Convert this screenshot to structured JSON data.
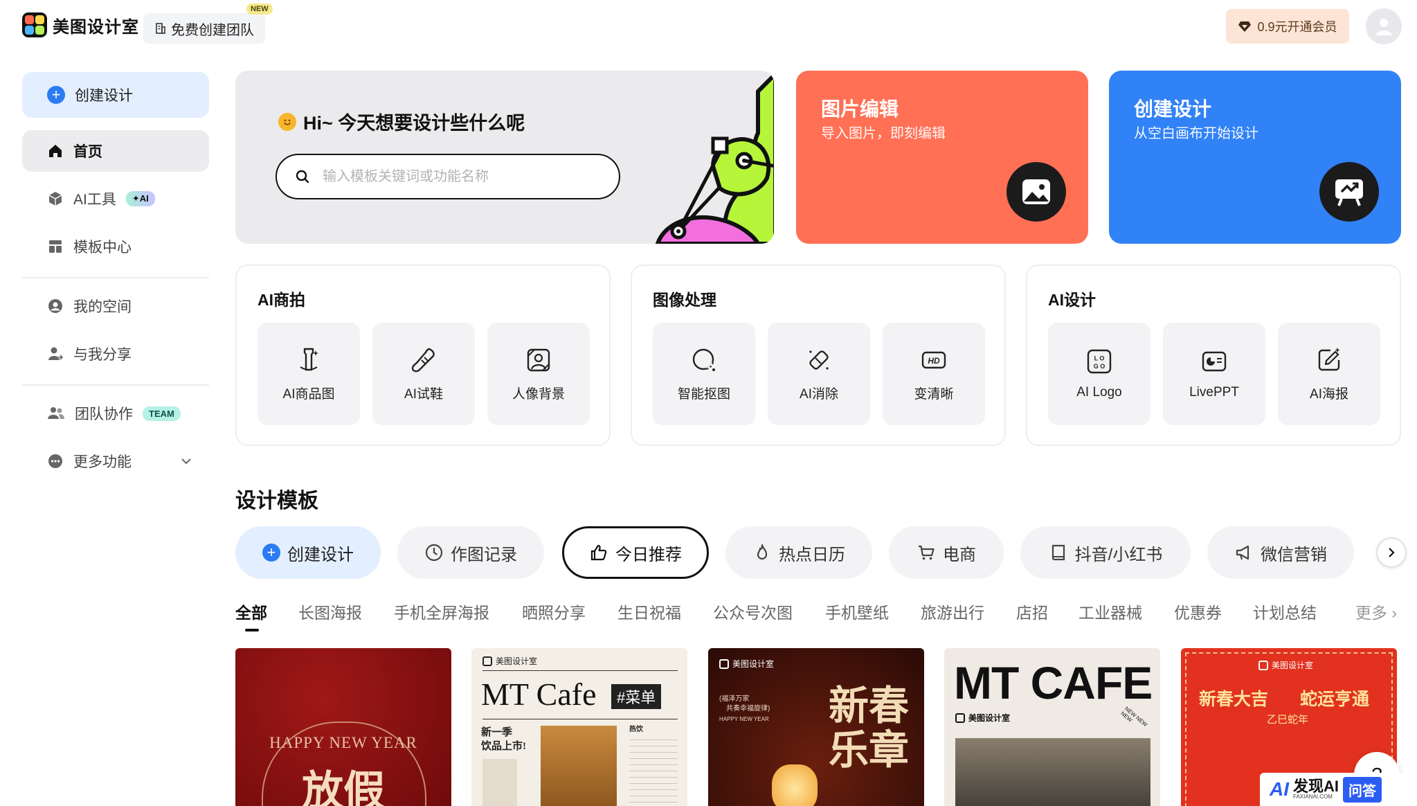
{
  "header": {
    "logo_text": "美图设计室",
    "team_button": "免费创建团队",
    "new_badge": "NEW",
    "vip_button": "0.9元开通会员"
  },
  "sidebar": {
    "create": "创建设计",
    "items": [
      {
        "label": "首页",
        "icon": "home-icon"
      },
      {
        "label": "AI工具",
        "badge": "✦AI",
        "icon": "cube-icon"
      },
      {
        "label": "模板中心",
        "icon": "template-icon"
      },
      {
        "label": "我的空间",
        "icon": "user-icon"
      },
      {
        "label": "与我分享",
        "icon": "share-user-icon"
      },
      {
        "label": "团队协作",
        "badge": "TEAM",
        "icon": "team-icon"
      },
      {
        "label": "更多功能",
        "icon": "more-icon"
      }
    ]
  },
  "hero": {
    "greeting": "Hi~ 今天想要设计些什么呢",
    "search_placeholder": "输入模板关键词或功能名称"
  },
  "cards": {
    "edit": {
      "title": "图片编辑",
      "subtitle": "导入图片，即刻编辑",
      "color": "#ff7055"
    },
    "create": {
      "title": "创建设计",
      "subtitle": "从空白画布开始设计",
      "color": "#3182f6"
    }
  },
  "panels": [
    {
      "title": "AI商拍",
      "tools": [
        "AI商品图",
        "AI试鞋",
        "人像背景"
      ]
    },
    {
      "title": "图像处理",
      "tools": [
        "智能抠图",
        "AI消除",
        "变清晰"
      ]
    },
    {
      "title": "AI设计",
      "tools": [
        "AI Logo",
        "LivePPT",
        "AI海报"
      ]
    }
  ],
  "templates": {
    "title": "设计模板",
    "pills": [
      "创建设计",
      "作图记录",
      "今日推荐",
      "热点日历",
      "电商",
      "抖音/小红书",
      "微信营销"
    ],
    "categories": [
      "全部",
      "长图海报",
      "手机全屏海报",
      "晒照分享",
      "生日祝福",
      "公众号次图",
      "手机壁纸",
      "旅游出行",
      "店招",
      "工业器械",
      "优惠券",
      "计划总结",
      "更多"
    ],
    "thumbs": {
      "t1": {
        "line1": "HAPPY NEW YEAR",
        "line2": "放假"
      },
      "t2": {
        "brand": "美图设计室",
        "title": "MT Cafe",
        "tag": "#菜单",
        "sub": "新一季",
        "sub2": "饮品上市!",
        "col": "热饮"
      },
      "t3": {
        "brand": "美图设计室",
        "small": "(福泽万家",
        "small2": "共奏幸福旋律)",
        "small3": "HAPPY NEW YEAR",
        "title": "新春",
        "title2": "乐章"
      },
      "t4": {
        "title": "MT CAFE",
        "brand": "美图设计室",
        "ring": "NEW NEW NEW"
      },
      "t5": {
        "brand": "美图设计室",
        "title": "新春大吉",
        "title2": "蛇运亨通",
        "sub": "乙巳蛇年"
      }
    }
  },
  "help": "?",
  "watermark": {
    "logo": "AI",
    "name": "发现AI",
    "sub": "FAXIANAI.COM",
    "tag": "问答"
  }
}
